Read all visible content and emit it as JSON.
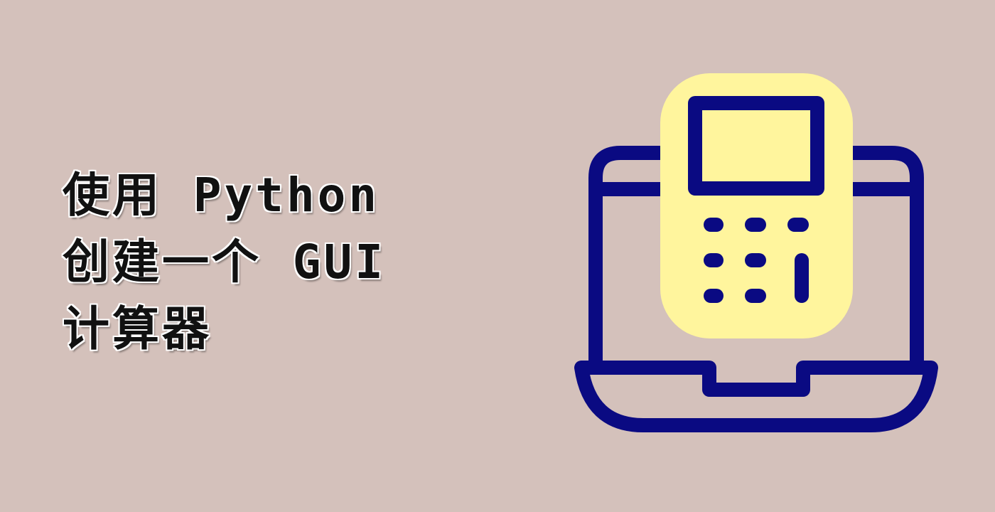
{
  "title": {
    "line1": "使用 Python",
    "line2": "创建一个 GUI",
    "line3": "计算器"
  },
  "illustration": {
    "icon": "laptop-calculator-icon",
    "colors": {
      "background": "#d4c1bb",
      "outline": "#0a0a82",
      "calculator_fill": "#fff59d",
      "title_text": "#111111"
    }
  }
}
